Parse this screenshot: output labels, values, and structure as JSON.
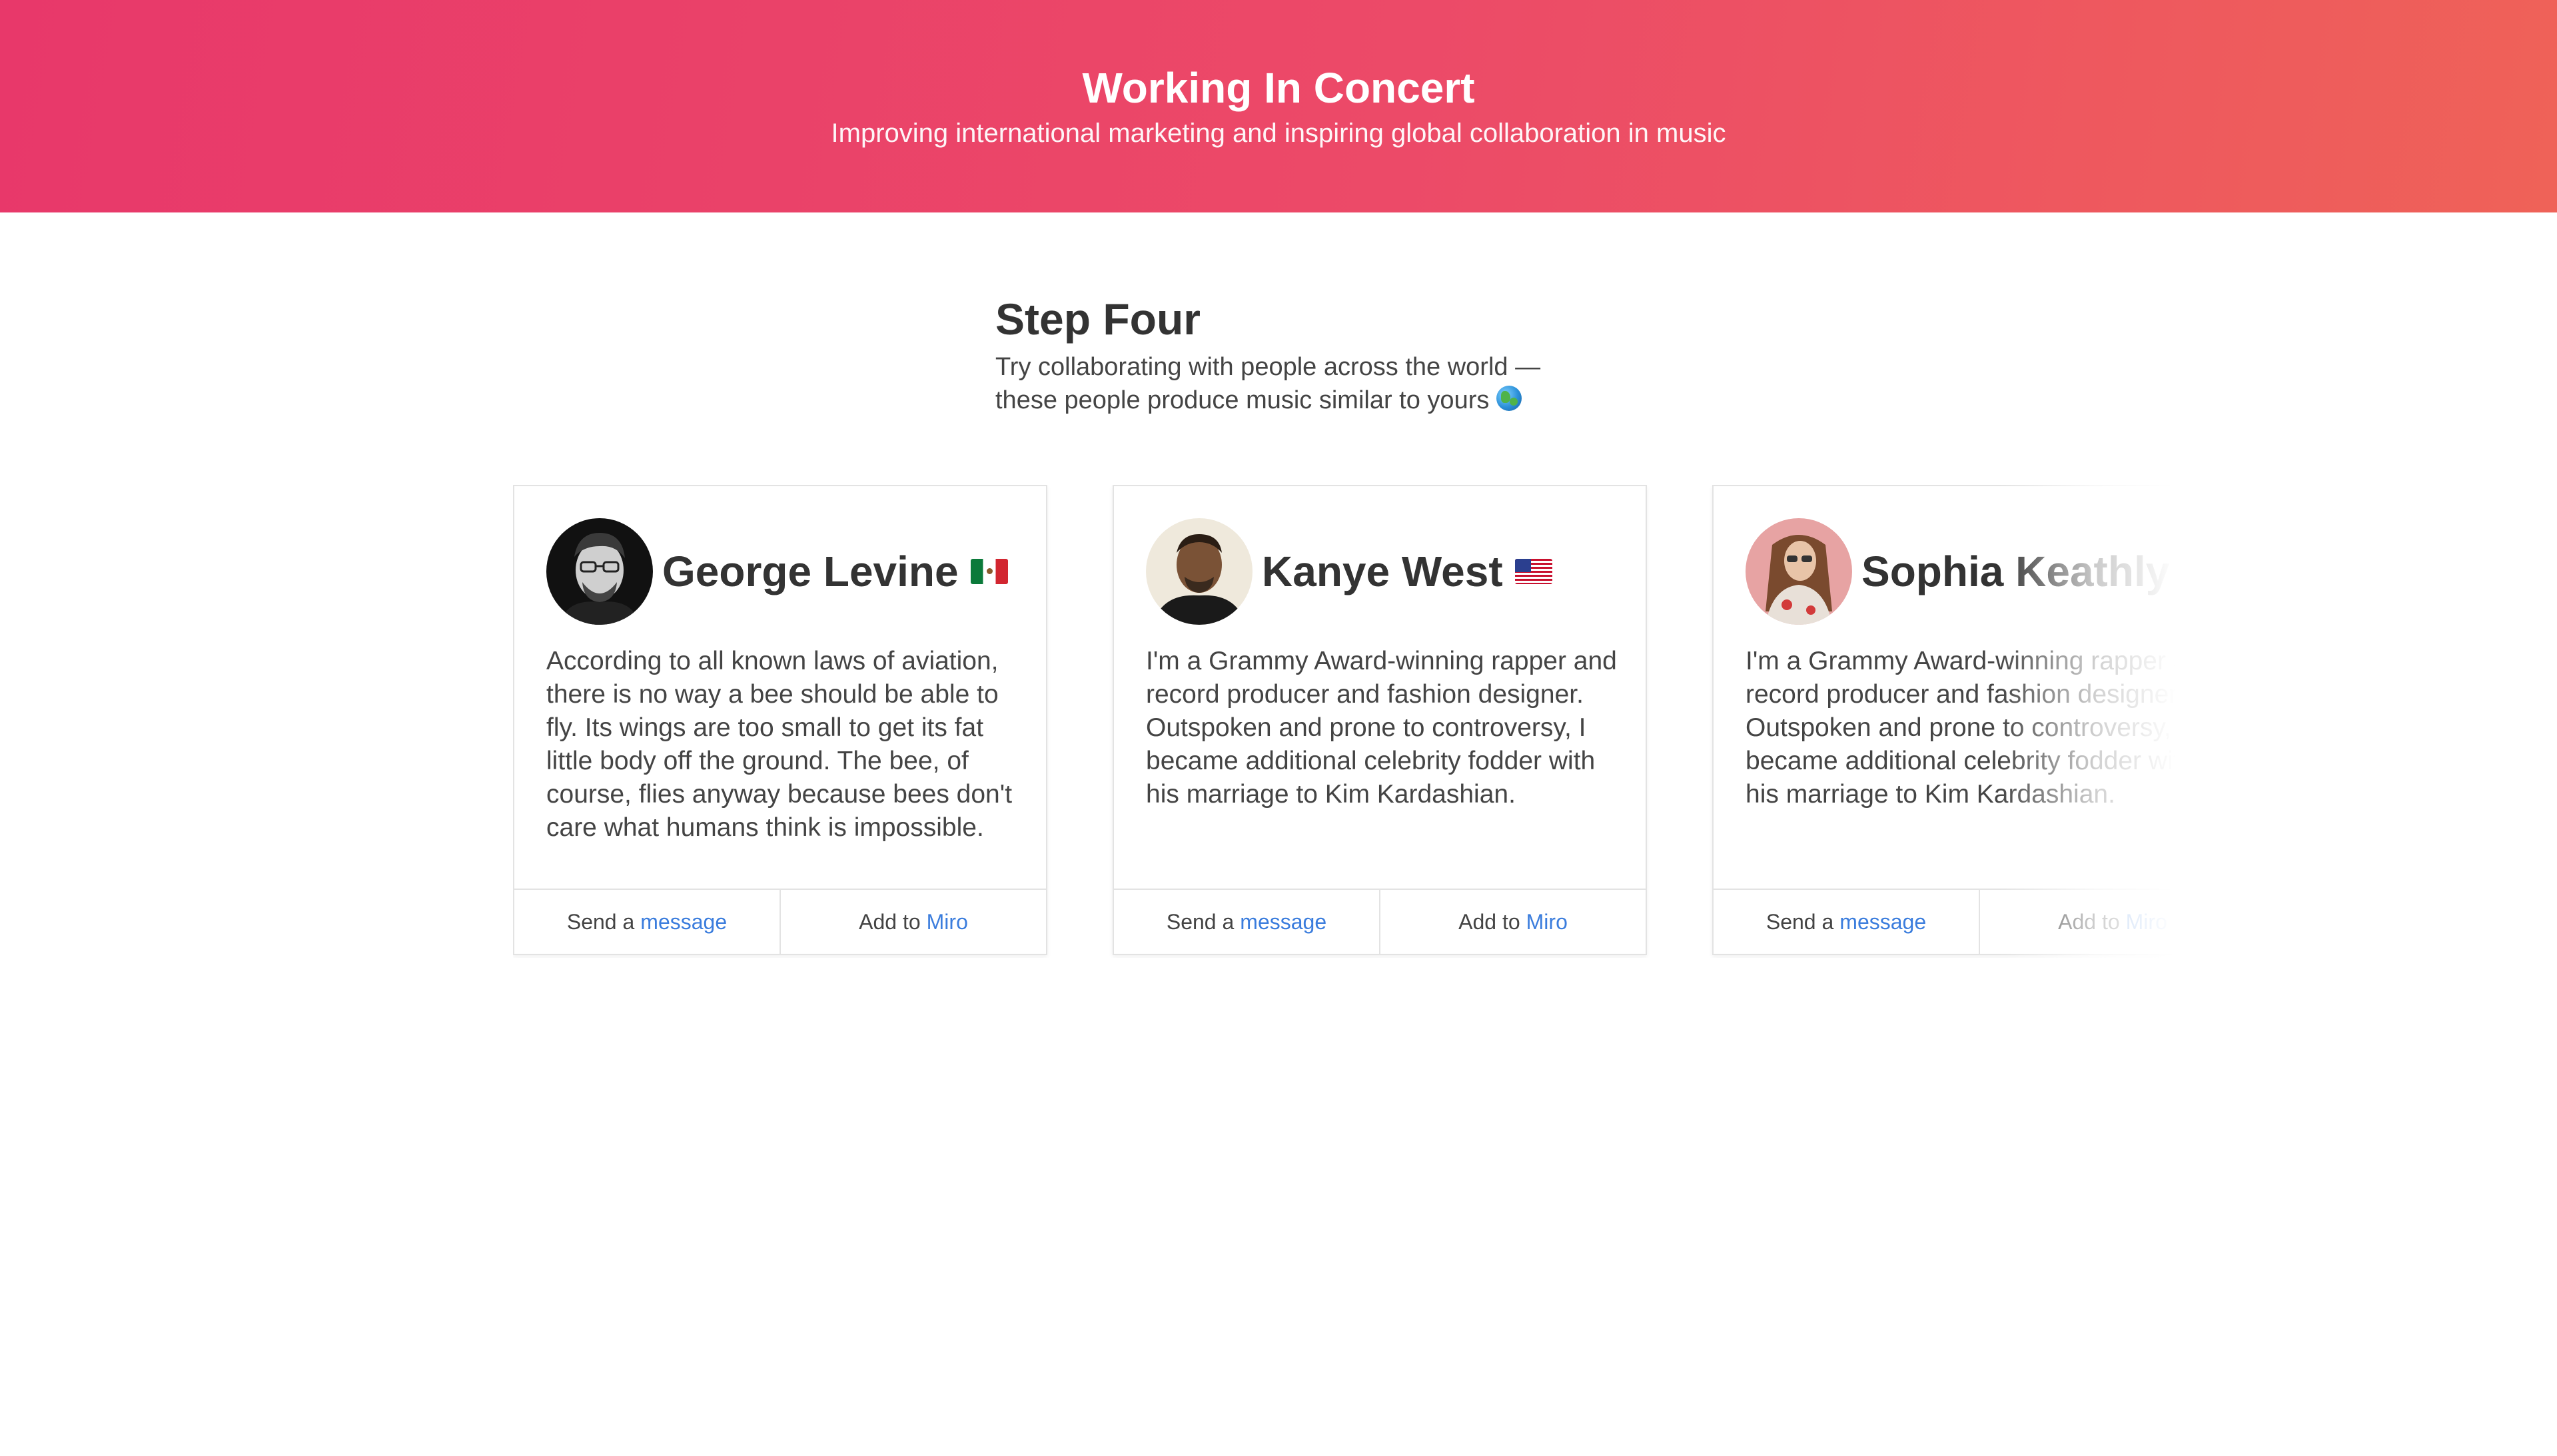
{
  "header": {
    "title": "Working In Concert",
    "subtitle": "Improving international marketing and inspiring global collaboration in music"
  },
  "step": {
    "title": "Step Four",
    "line1": "Try collaborating with people across the world —",
    "line2": "these people produce music similar to yours",
    "icon": "globe-icon"
  },
  "cards": [
    {
      "name": "George Levine",
      "flag": "mexico-flag-icon",
      "bio": "According to all known laws of aviation, there is no way a bee should be able to fly. Its wings are too small to get its fat little body off the ground. The bee, of course, flies anyway because bees don't care what humans think is impossible.",
      "message_prefix": "Send a",
      "message_link": "message",
      "miro_prefix": "Add to",
      "miro_link": "Miro"
    },
    {
      "name": "Kanye West",
      "flag": "usa-flag-icon",
      "bio": "I'm a Grammy Award-winning rapper and record producer and fashion designer. Outspoken and prone to controversy, I became additional celebrity fodder with his marriage to Kim Kardashian.",
      "message_prefix": "Send a",
      "message_link": "message",
      "miro_prefix": "Add to",
      "miro_link": "Miro"
    },
    {
      "name": "Sophia Keathly",
      "flag": "",
      "bio": "I'm a Grammy Award-winning rapper and record producer and fashion designer. Outspoken and prone to controversy, I became additional celebrity fodder with his marriage to Kim Kardashian.",
      "message_prefix": "Send a",
      "message_link": "message",
      "miro_prefix": "Add to",
      "miro_link": "Miro"
    }
  ],
  "colors": {
    "header_gradient_start": "#e8386a",
    "header_gradient_end": "#ef6258",
    "link": "#3b7ddd"
  }
}
